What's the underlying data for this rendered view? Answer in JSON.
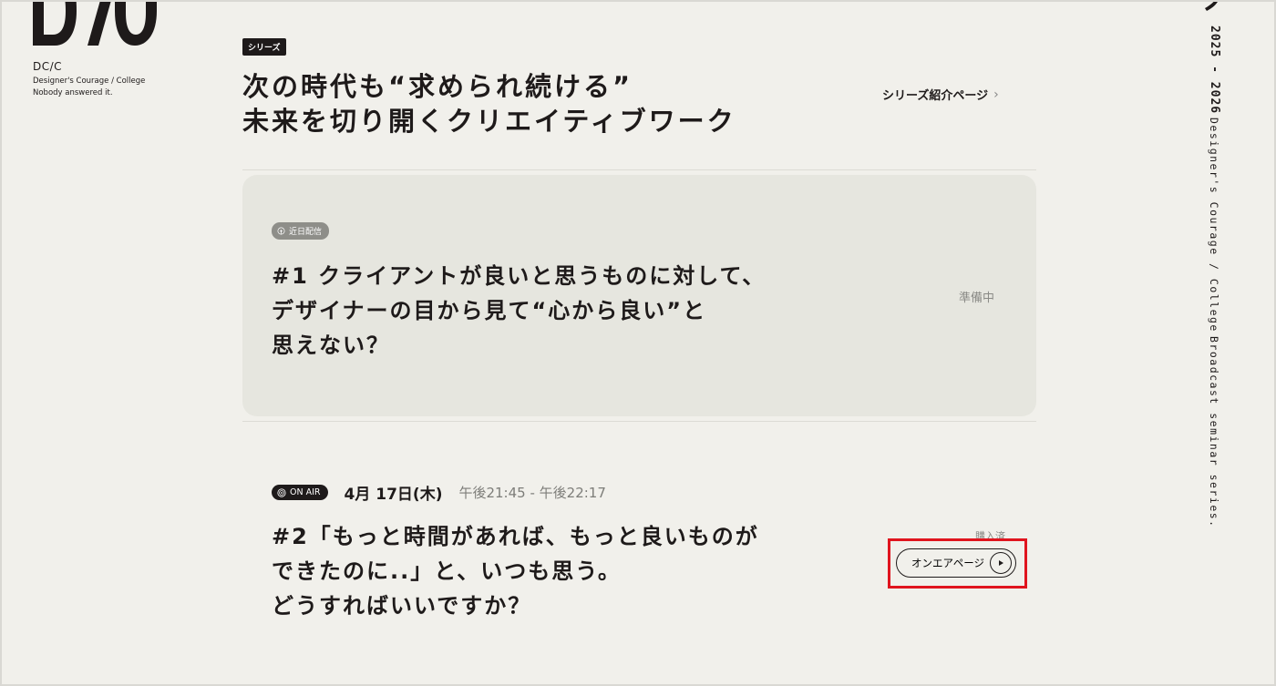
{
  "brand": {
    "name": "DC/C",
    "tagline_1": "Designer's Courage / College",
    "tagline_2": "Nobody answered it."
  },
  "side": {
    "year": "2025 - 2026",
    "line_1": "Designer's Courage / College",
    "line_2": "Broadcast seminar series."
  },
  "header": {
    "series_tag": "シリーズ",
    "title_line_1": "次の時代も“求められ続ける”",
    "title_line_2": "未来を切り開くクリエイティブワーク",
    "series_link": "シリーズ紹介ページ",
    "chevron": "›"
  },
  "episodes": [
    {
      "badge": "近日配信",
      "title_line_1": "#1 クライアントが良いと思うものに対して、",
      "title_line_2": "デザイナーの目から見て“心から良い”と",
      "title_line_3": "思えない？",
      "status": "準備中"
    },
    {
      "badge": "ON AIR",
      "date": "4月 17日(木)",
      "time": "午後21:45 - 午後22:17",
      "title_line_1": "#2「もっと時間があれば、もっと良いものが",
      "title_line_2": "できたのに..」と、いつも思う。",
      "title_line_3": "どうすればいいですか？",
      "purchased": "購入済",
      "button": "オンエアページ"
    }
  ],
  "colors": {
    "background": "#f1f0eb",
    "card": "#e6e6df",
    "ink": "#1e1a1a",
    "muted": "#8a8a86",
    "highlight": "#e0141e"
  }
}
